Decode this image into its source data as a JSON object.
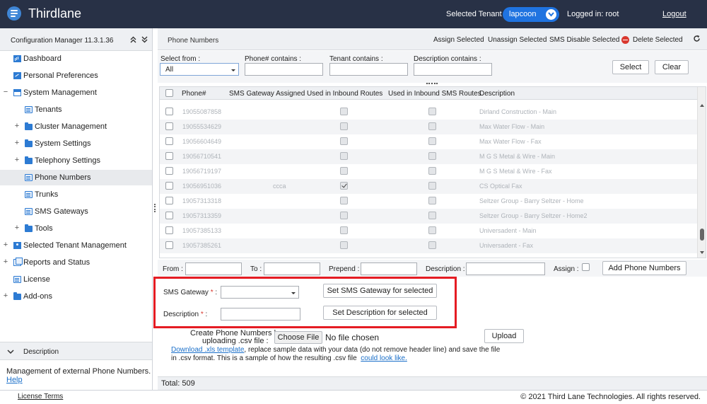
{
  "header": {
    "app_title": "Thirdlane",
    "selected_tenant_label": "Selected Tenant :",
    "selected_tenant_value": "lapcoon",
    "logged_in": "Logged in: root",
    "logout": "Logout"
  },
  "sidebar": {
    "title": "Configuration Manager 11.3.1.36",
    "items": [
      {
        "label": "Dashboard",
        "icon": "dashboard-icon"
      },
      {
        "label": "Personal Preferences",
        "icon": "preferences-icon"
      },
      {
        "label": "System Management",
        "icon": "window-icon",
        "expander": "−"
      },
      {
        "label": "Tenants",
        "icon": "document-icon"
      },
      {
        "label": "Cluster Management",
        "icon": "folder-icon",
        "expander": "+"
      },
      {
        "label": "System Settings",
        "icon": "folder-icon",
        "expander": "+"
      },
      {
        "label": "Telephony Settings",
        "icon": "folder-icon",
        "expander": "+"
      },
      {
        "label": "Phone Numbers",
        "icon": "document-icon"
      },
      {
        "label": "Trunks",
        "icon": "document-icon"
      },
      {
        "label": "SMS Gateways",
        "icon": "document-icon"
      },
      {
        "label": "Tools",
        "icon": "folder-icon",
        "expander": "+"
      },
      {
        "label": "Selected Tenant Management",
        "icon": "tenant-icon",
        "expander": "+"
      },
      {
        "label": "Reports and Status",
        "icon": "documents-icon",
        "expander": "+"
      },
      {
        "label": "License",
        "icon": "document-icon"
      },
      {
        "label": "Add-ons",
        "icon": "folder-icon",
        "expander": "+"
      }
    ],
    "description_title": "Description",
    "description_text": "Management of external Phone Numbers.",
    "help_link": "Help"
  },
  "toolbar": {
    "title": "Phone Numbers",
    "assign": "Assign Selected",
    "unassign": "Unassign Selected",
    "sms_disable": "SMS Disable Selected",
    "delete": "Delete Selected"
  },
  "filters": {
    "select_from_label": "Select from :",
    "select_from_value": "All",
    "phone_contains_label": "Phone# contains   :",
    "tenant_contains_label": "Tenant contains   :",
    "description_contains_label": "Description contains   :",
    "select_button": "Select",
    "clear_button": "Clear"
  },
  "table": {
    "columns": [
      "Phone#",
      "SMS Gateway Assigned",
      "Used in Inbound Routes",
      "Used in Inbound SMS Routes",
      "Description"
    ],
    "rows": [
      {
        "phone": "19055087858",
        "gateway": "",
        "inbound": false,
        "sms": false,
        "description": "Dirland Construction - Main"
      },
      {
        "phone": "19055534629",
        "gateway": "",
        "inbound": false,
        "sms": false,
        "description": "Max Water Flow - Main"
      },
      {
        "phone": "19056604649",
        "gateway": "",
        "inbound": false,
        "sms": false,
        "description": "Max Water Flow - Fax"
      },
      {
        "phone": "19056710541",
        "gateway": "",
        "inbound": false,
        "sms": false,
        "description": "M G S Metal & Wire - Main"
      },
      {
        "phone": "19056719197",
        "gateway": "",
        "inbound": false,
        "sms": false,
        "description": "M G S Metal & Wire - Fax"
      },
      {
        "phone": "19056951036",
        "gateway": "ccca",
        "inbound": true,
        "sms": false,
        "description": "CS Optical Fax"
      },
      {
        "phone": "19057313318",
        "gateway": "",
        "inbound": false,
        "sms": false,
        "description": "Seltzer Group - Barry Seltzer - Home"
      },
      {
        "phone": "19057313359",
        "gateway": "",
        "inbound": false,
        "sms": false,
        "description": "Seltzer Group - Barry Seltzer - Home2"
      },
      {
        "phone": "19057385133",
        "gateway": "",
        "inbound": false,
        "sms": false,
        "description": "Universadent - Main"
      },
      {
        "phone": "19057385261",
        "gateway": "",
        "inbound": false,
        "sms": false,
        "description": "Universadent - Fax"
      }
    ]
  },
  "add_form": {
    "from_label": "From :",
    "to_label": "To :",
    "prepend_label": "Prepend :",
    "description_label": "Description :",
    "assign_label": "Assign :",
    "add_button": "Add Phone Numbers"
  },
  "sms_form": {
    "gateway_label": "SMS Gateway",
    "description_label": "Description",
    "required_mark": "*",
    "colon": ":",
    "set_gateway_button": "Set SMS Gateway for selected",
    "set_description_button": "Set Description for selected"
  },
  "upload": {
    "label_line1": "Create Phone Numbers by",
    "label_line2": "uploading .csv file :",
    "choose_file": "Choose File",
    "no_file": "No file chosen",
    "upload_button": "Upload",
    "template_link": "Download .xls template",
    "note_part1": ", replace sample data with your data (do not remove header line) and save the file",
    "note_part2": "in .csv format.  This is a sample of how the resulting .csv file",
    "sample_link": "could look like."
  },
  "total": "Total: 509",
  "footer": {
    "license_terms": "License Terms",
    "copyright": "© 2021 Third Lane Technologies. All rights reserved."
  },
  "colors": {
    "header_bg": "#283146",
    "accent": "#1f73e0",
    "highlight_box": "#e51c23",
    "link": "#1a6fc9"
  }
}
